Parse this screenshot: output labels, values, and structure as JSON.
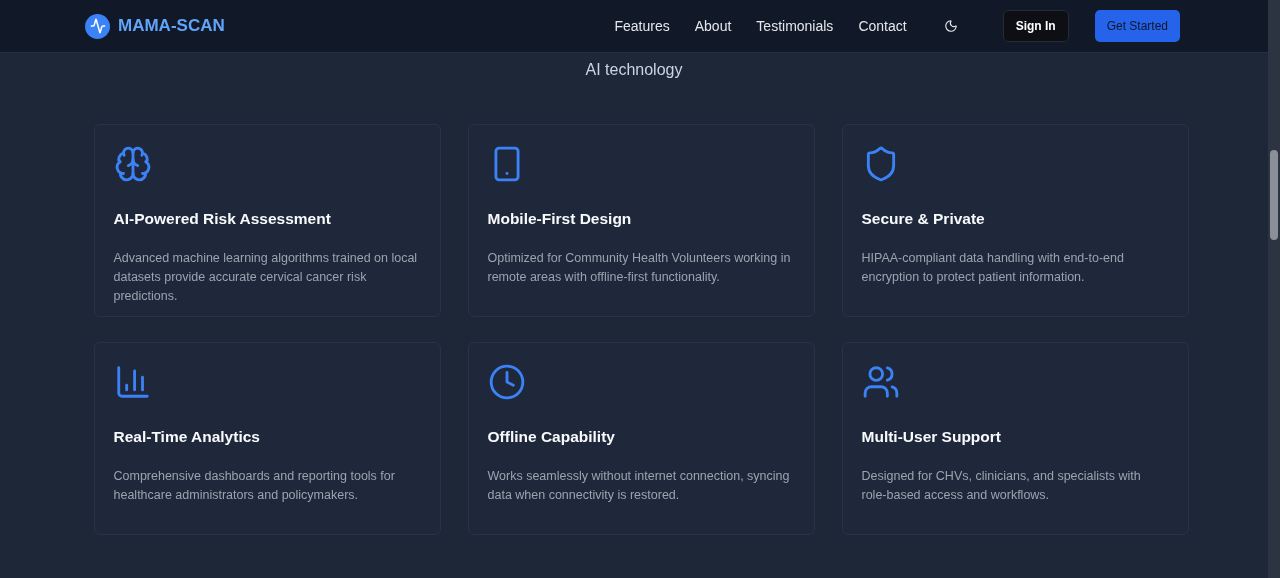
{
  "header": {
    "brand": "MAMA-SCAN",
    "nav": [
      "Features",
      "About",
      "Testimonials",
      "Contact"
    ],
    "sign_in": "Sign In",
    "get_started": "Get Started"
  },
  "subtitle": "AI technology",
  "features": [
    {
      "title": "AI-Powered Risk Assessment",
      "description": "Advanced machine learning algorithms trained on local datasets provide accurate cervical cancer risk predictions."
    },
    {
      "title": "Mobile-First Design",
      "description": "Optimized for Community Health Volunteers working in remote areas with offline-first functionality."
    },
    {
      "title": "Secure & Private",
      "description": "HIPAA-compliant data handling with end-to-end encryption to protect patient information."
    },
    {
      "title": "Real-Time Analytics",
      "description": "Comprehensive dashboards and reporting tools for healthcare administrators and policymakers."
    },
    {
      "title": "Offline Capability",
      "description": "Works seamlessly without internet connection, syncing data when connectivity is restored."
    },
    {
      "title": "Multi-User Support",
      "description": "Designed for CHVs, clinicians, and specialists with role-based access and workflows."
    }
  ]
}
